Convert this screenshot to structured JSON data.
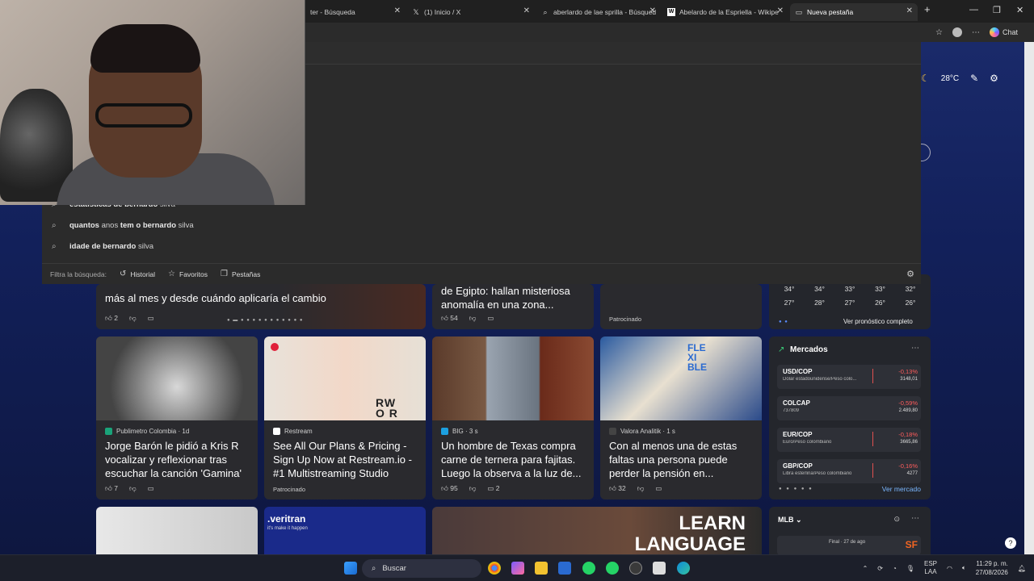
{
  "tabs": [
    {
      "label": "ter - Búsqueda",
      "icon": "search-icon"
    },
    {
      "label": "(1) Inicio / X",
      "icon": "x-logo-icon"
    },
    {
      "label": "aberlardo de lae sprilla - Búsqued",
      "icon": "search-icon"
    },
    {
      "label": "Abelardo de la Espriella - Wikipe",
      "icon": "wikipedia-icon"
    },
    {
      "label": "Nueva pestaña",
      "icon": "page-icon"
    }
  ],
  "toolbar": {
    "chat_label": "Chat"
  },
  "header": {
    "temp": "28°C"
  },
  "suggestions": [
    {
      "bold": "estatísticas de bernardo",
      "rest": " silva"
    },
    {
      "bold": "quantos",
      "rest": " anos ",
      "bold2": "tem o bernardo",
      "rest2": " silva"
    },
    {
      "bold": "idade de bernardo",
      "rest": " silva"
    }
  ],
  "filter": {
    "label": "Filtra la búsqueda:",
    "historial": "Historial",
    "favoritos": "Favoritos",
    "pestanas": "Pestañas"
  },
  "top_cards": [
    {
      "title": "más al mes y desde cuándo aplicaría el cambio",
      "likes": "2"
    },
    {
      "title_line1": "de Egipto: hallan misteriosa",
      "title_line2": "anomalía en una zona...",
      "likes": "54"
    },
    {
      "sponsor": "Patrocinado"
    }
  ],
  "weather": {
    "highs": [
      "34°",
      "34°",
      "33°",
      "33°",
      "32°"
    ],
    "lows": [
      "27°",
      "28°",
      "27°",
      "26°",
      "26°"
    ],
    "forecast_link": "Ver pronóstico completo"
  },
  "cards": [
    {
      "source": "Publimetro Colombia · 1d",
      "title": "Jorge Barón le pidió a Kris R vocalizar y reflexionar tras escuchar la canción 'Gamina'",
      "likes": "7"
    },
    {
      "source": "Restream",
      "title": "See All Our Plans & Pricing - Sign Up Now at Restream.io - #1 Multistreaming Studio",
      "sponsor": "Patrocinado"
    },
    {
      "source": "BIG · 3 s",
      "title": "Un hombre de Texas compra carne de ternera para fajitas. Luego la observa a la luz de...",
      "likes": "95",
      "comments": "2"
    },
    {
      "source": "Valora Analitik · 1 s",
      "title": "Con al menos una de estas faltas una persona puede perder la pensión en...",
      "likes": "32"
    }
  ],
  "markets": {
    "title": "Mercados",
    "link": "Ver mercado",
    "rows": [
      {
        "sym": "USD/COP",
        "desc": "Dólar estadounidense/Peso colo...",
        "chg": "-0,13%",
        "val": "3148,01"
      },
      {
        "sym": "COLCAP",
        "desc": "737809",
        "chg": "-0,59%",
        "val": "2.489,80"
      },
      {
        "sym": "EUR/COP",
        "desc": "Euro/Peso colombiano",
        "chg": "-0,18%",
        "val": "3665,86"
      },
      {
        "sym": "GBP/COP",
        "desc": "Libra esterlina/Peso colombiano",
        "chg": "-0,16%",
        "val": "4277"
      }
    ]
  },
  "mlb": {
    "title": "MLB",
    "status": "Final · 27 de ago"
  },
  "bottom_cards": [
    {
      "text": ".veritran",
      "sub": "it's make it happen"
    },
    {
      "text": "LEARN",
      "text2": "LANGUAGE"
    }
  ],
  "taskbar": {
    "search": "Buscar",
    "lang1": "ESP",
    "lang2": "LAA",
    "time": "11:29 p. m.",
    "date": "27/08/2026"
  },
  "colors": {
    "accent": "#2b7cd3",
    "negative": "#ff5c5c",
    "link": "#7ab7ff"
  }
}
